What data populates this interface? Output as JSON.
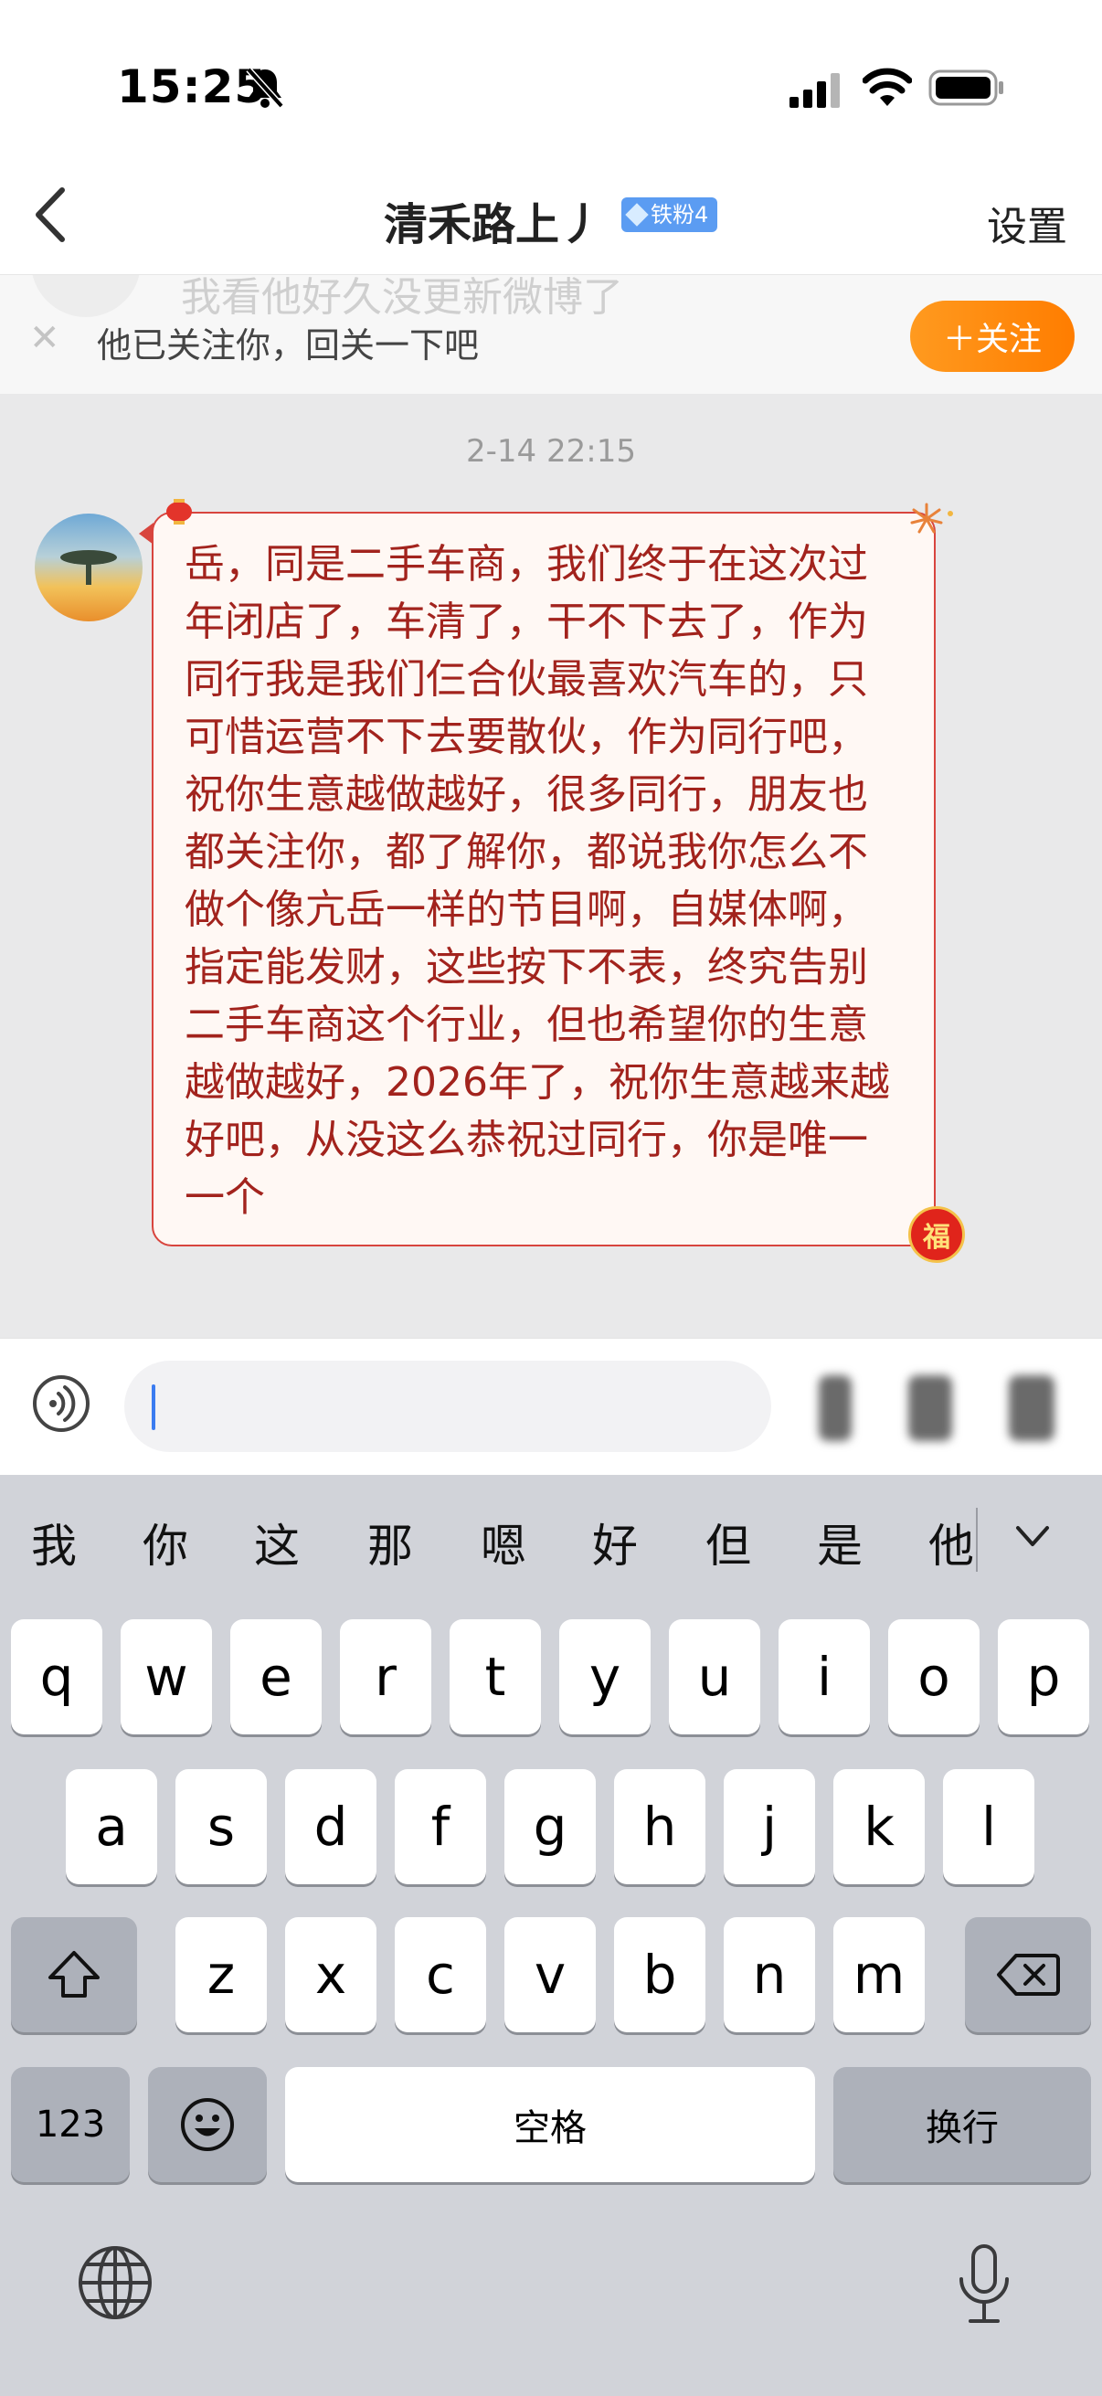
{
  "status_bar": {
    "time": "15:25",
    "icons": [
      "bell-slash-icon",
      "cellular-signal-icon",
      "wifi-icon",
      "battery-icon"
    ]
  },
  "nav": {
    "title": "清禾路上丿",
    "fan_badge": "铁粉4",
    "settings_label": "设置"
  },
  "banner": {
    "ghost_text": "我看他好久没更新微博了",
    "text": "他已关注你，回关一下吧",
    "follow_label": "＋关注"
  },
  "chat": {
    "timestamp": "2-14 22:15",
    "message": "岳，同是二手车商，我们终于在这次过年闭店了，车清了，干不下去了，作为同行我是我们仨合伙最喜欢汽车的，只可惜运营不下去要散伙，作为同行吧，祝你生意越做越好，很多同行，朋友也都关注你，都了解你，都说我你怎么不做个像亢岳一样的节目啊，自媒体啊，指定能发财，这些按下不表，终究告别二手车商这个行业，但也希望你的生意越做越好，2026年了，祝你生意越来越好吧，从没这么恭祝过同行，你是唯一一个",
    "fu_badge": "福"
  },
  "input": {
    "value": "",
    "placeholder": ""
  },
  "keyboard": {
    "candidates": [
      "我",
      "你",
      "这",
      "那",
      "嗯",
      "好",
      "但",
      "是",
      "他"
    ],
    "row1": [
      "q",
      "w",
      "e",
      "r",
      "t",
      "y",
      "u",
      "i",
      "o",
      "p"
    ],
    "row2": [
      "a",
      "s",
      "d",
      "f",
      "g",
      "h",
      "j",
      "k",
      "l"
    ],
    "row3": [
      "z",
      "x",
      "c",
      "v",
      "b",
      "n",
      "m"
    ],
    "numbers_label": "123",
    "space_label": "空格",
    "return_label": "换行"
  },
  "colors": {
    "accent_orange": "#ff8a0f",
    "bubble_border": "#d8453e",
    "bubble_text": "#a2231d",
    "badge_blue": "#5b9cf2"
  }
}
